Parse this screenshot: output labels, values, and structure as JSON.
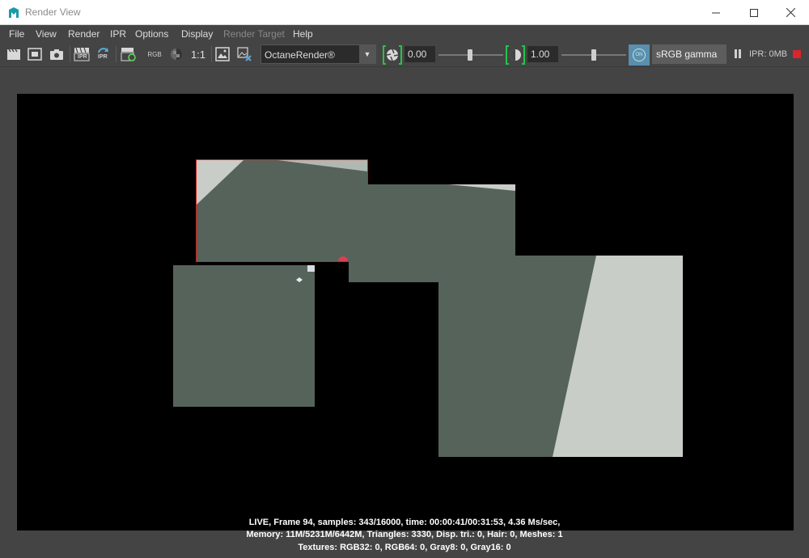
{
  "window": {
    "title": "Render View",
    "controls": [
      "minimize-icon",
      "maximize-icon",
      "close-icon"
    ]
  },
  "menu": [
    {
      "label": "File",
      "disabled": false
    },
    {
      "label": "View",
      "disabled": false
    },
    {
      "label": "Render",
      "disabled": false
    },
    {
      "label": "IPR",
      "disabled": false
    },
    {
      "label": "Options",
      "disabled": false
    },
    {
      "label": "Display",
      "disabled": false
    },
    {
      "label": "Render Target",
      "disabled": true
    },
    {
      "label": "Help",
      "disabled": false
    }
  ],
  "toolbar": {
    "icons": [
      "clapperboard-icon",
      "render-region-icon",
      "snapshot-camera-icon",
      "ipr-render-icon",
      "ipr-refresh-icon",
      "render-sequence-icon",
      "rgb-channel-icon",
      "alpha-channel-icon",
      "real-size-icon",
      "keep-image-icon",
      "remove-image-icon"
    ],
    "rgb_label": "RGB",
    "ratio_label": "1:1",
    "ipr_label": "IPR",
    "renderer": "OctaneRender®",
    "exposure_value": "0.00",
    "gamma_value": "1.00",
    "on_label": "ON",
    "color_space": "sRGB gamma",
    "ipr_memory": "IPR: 0MB",
    "accent_green": "#27c24a",
    "stop_color": "#d8262c"
  },
  "render": {
    "status_lines": [
      "LIVE, Frame 94, samples: 343/16000, time: 00:00:41/00:31:53, 4.36 Ms/sec,",
      "Memory: 11M/5231M/6442M, Triangles: 3330, Disp. tri.: 0, Hair: 0, Meshes: 1",
      "Textures: RGB32: 0, RGB64: 0, Gray8: 0, Gray16: 0"
    ],
    "tile_color": "#56635a",
    "highlight_color": "#c8cdc8",
    "active_bucket_color": "#e0191f"
  }
}
